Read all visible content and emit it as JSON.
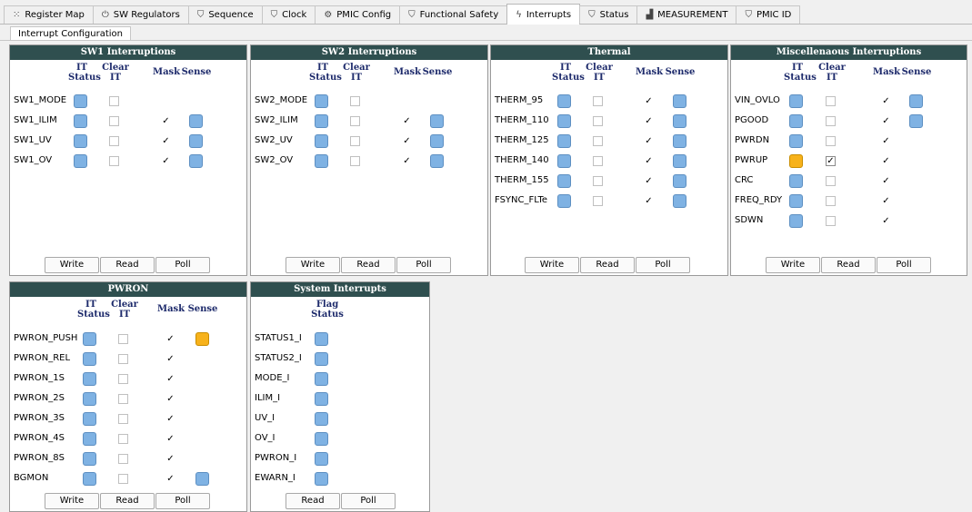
{
  "tabs": [
    {
      "label": "Register Map",
      "icon": "grid-icon",
      "glyph": "⁙"
    },
    {
      "label": "SW Regulators",
      "icon": "power-icon",
      "glyph": "⏻"
    },
    {
      "label": "Sequence",
      "icon": "shield-check-icon",
      "glyph": "⛉"
    },
    {
      "label": "Clock",
      "icon": "shield-check-icon",
      "glyph": "⛉"
    },
    {
      "label": "PMIC Config",
      "icon": "gear-icon",
      "glyph": "⚙"
    },
    {
      "label": "Functional Safety",
      "icon": "shield-check-icon",
      "glyph": "⛉"
    },
    {
      "label": "Interrupts",
      "icon": "lightning-icon",
      "glyph": "ϟ",
      "active": true
    },
    {
      "label": "Status",
      "icon": "shield-check-icon",
      "glyph": "⛉"
    },
    {
      "label": "MEASUREMENT",
      "icon": "bar-chart-icon",
      "glyph": "▟"
    },
    {
      "label": "PMIC ID",
      "icon": "shield-check-icon",
      "glyph": "⛉"
    }
  ],
  "subtab": "Interrupt Configuration",
  "headers": {
    "it_status": [
      "IT",
      "Status"
    ],
    "clear_it": [
      "Clear",
      "IT"
    ],
    "mask": "Mask",
    "sense": "Sense",
    "flag_status": [
      "Flag",
      "Status"
    ]
  },
  "buttons": {
    "write": "Write",
    "read": "Read",
    "poll": "Poll"
  },
  "colors": {
    "title_bar": "#2f4f4f",
    "led_off": "#7fb2e3",
    "led_on": "#f7b21b",
    "header_text": "#1d2a6b"
  },
  "panels": {
    "sw1": {
      "title": "SW1 Interruptions",
      "rows": [
        {
          "label": "SW1_MODE",
          "it": false,
          "clear": false,
          "mask": null,
          "sense": null
        },
        {
          "label": "SW1_ILIM",
          "it": false,
          "clear": false,
          "mask": true,
          "sense": false
        },
        {
          "label": "SW1_UV",
          "it": false,
          "clear": false,
          "mask": true,
          "sense": false
        },
        {
          "label": "SW1_OV",
          "it": false,
          "clear": false,
          "mask": true,
          "sense": false
        }
      ]
    },
    "sw2": {
      "title": "SW2 Interruptions",
      "rows": [
        {
          "label": "SW2_MODE",
          "it": false,
          "clear": false,
          "mask": null,
          "sense": null
        },
        {
          "label": "SW2_ILIM",
          "it": false,
          "clear": false,
          "mask": true,
          "sense": false
        },
        {
          "label": "SW2_UV",
          "it": false,
          "clear": false,
          "mask": true,
          "sense": false
        },
        {
          "label": "SW2_OV",
          "it": false,
          "clear": false,
          "mask": true,
          "sense": false
        }
      ]
    },
    "thermal": {
      "title": "Thermal",
      "rows": [
        {
          "label": "THERM_95",
          "it": false,
          "clear": false,
          "mask": true,
          "sense": false
        },
        {
          "label": "THERM_110",
          "it": false,
          "clear": false,
          "mask": true,
          "sense": false
        },
        {
          "label": "THERM_125",
          "it": false,
          "clear": false,
          "mask": true,
          "sense": false
        },
        {
          "label": "THERM_140",
          "it": false,
          "clear": false,
          "mask": true,
          "sense": false
        },
        {
          "label": "THERM_155",
          "it": false,
          "clear": false,
          "mask": true,
          "sense": false
        },
        {
          "label": "FSYNC_FLTe",
          "it": false,
          "clear": false,
          "mask": true,
          "sense": false
        }
      ]
    },
    "misc": {
      "title": "Miscellenaous Interruptions",
      "rows": [
        {
          "label": "VIN_OVLO",
          "it": false,
          "clear": false,
          "mask": true,
          "sense": false
        },
        {
          "label": "PGOOD",
          "it": false,
          "clear": false,
          "mask": true,
          "sense": false
        },
        {
          "label": "PWRDN",
          "it": false,
          "clear": false,
          "mask": true,
          "sense": null
        },
        {
          "label": "PWRUP",
          "it": true,
          "clear": true,
          "mask": true,
          "sense": null
        },
        {
          "label": "CRC",
          "it": false,
          "clear": false,
          "mask": true,
          "sense": null
        },
        {
          "label": "FREQ_RDY",
          "it": false,
          "clear": false,
          "mask": true,
          "sense": null
        },
        {
          "label": "SDWN",
          "it": false,
          "clear": false,
          "mask": true,
          "sense": null
        }
      ]
    },
    "pwron": {
      "title": "PWRON",
      "rows": [
        {
          "label": "PWRON_PUSH",
          "it": false,
          "clear": false,
          "mask": true,
          "sense": true
        },
        {
          "label": "PWRON_REL",
          "it": false,
          "clear": false,
          "mask": true,
          "sense": null
        },
        {
          "label": "PWRON_1S",
          "it": false,
          "clear": false,
          "mask": true,
          "sense": null
        },
        {
          "label": "PWRON_2S",
          "it": false,
          "clear": false,
          "mask": true,
          "sense": null
        },
        {
          "label": "PWRON_3S",
          "it": false,
          "clear": false,
          "mask": true,
          "sense": null
        },
        {
          "label": "PWRON_4S",
          "it": false,
          "clear": false,
          "mask": true,
          "sense": null
        },
        {
          "label": "PWRON_8S",
          "it": false,
          "clear": false,
          "mask": true,
          "sense": null
        },
        {
          "label": "BGMON",
          "it": false,
          "clear": false,
          "mask": true,
          "sense": false
        }
      ]
    },
    "system": {
      "title": "System Interrupts",
      "rows": [
        {
          "label": "STATUS1_I",
          "flag": false
        },
        {
          "label": "STATUS2_I",
          "flag": false
        },
        {
          "label": "MODE_I",
          "flag": false
        },
        {
          "label": "ILIM_I",
          "flag": false
        },
        {
          "label": "UV_I",
          "flag": false
        },
        {
          "label": "OV_I",
          "flag": false
        },
        {
          "label": "PWRON_I",
          "flag": false
        },
        {
          "label": "EWARN_I",
          "flag": false
        }
      ]
    }
  }
}
